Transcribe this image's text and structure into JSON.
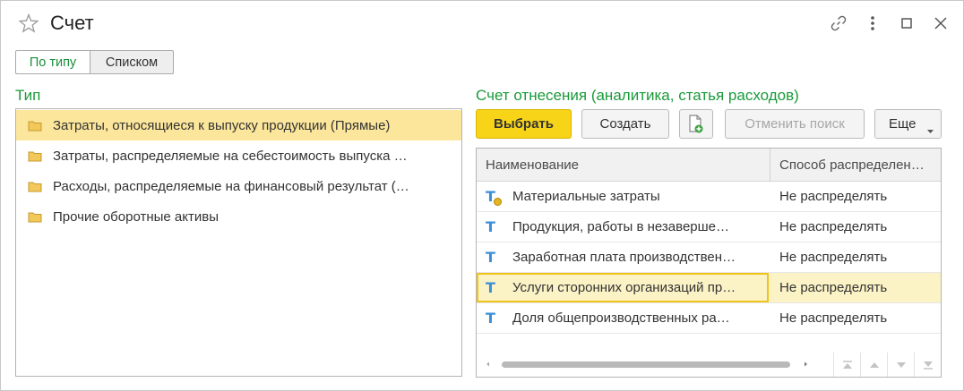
{
  "window": {
    "title": "Счет"
  },
  "view_toggle": {
    "by_type": "По типу",
    "by_list": "Списком"
  },
  "left": {
    "section_label": "Тип",
    "items": [
      {
        "label": "Затраты, относящиеся к выпуску продукции (Прямые)",
        "selected": true
      },
      {
        "label": "Затраты, распределяемые на себестоимость выпуска …",
        "selected": false
      },
      {
        "label": "Расходы, распределяемые на финансовый результат (…",
        "selected": false
      },
      {
        "label": "Прочие оборотные активы",
        "selected": false
      }
    ]
  },
  "right": {
    "section_label": "Счет отнесения (аналитика, статья расходов)",
    "toolbar": {
      "select": "Выбрать",
      "create": "Создать",
      "cancel_search": "Отменить поиск",
      "more": "Еще"
    },
    "table": {
      "columns": [
        "Наименование",
        "Способ распределен…"
      ],
      "rows": [
        {
          "name": "Материальные затраты",
          "method": "Не распределять",
          "icon": "type-icon-marked",
          "selected": false
        },
        {
          "name": "Продукция, работы в незаверше…",
          "method": "Не распределять",
          "icon": "type-icon",
          "selected": false
        },
        {
          "name": "Заработная плата производствен…",
          "method": "Не распределять",
          "icon": "type-icon",
          "selected": false
        },
        {
          "name": "Услуги сторонних организаций пр…",
          "method": "Не распределять",
          "icon": "type-icon",
          "selected": true
        },
        {
          "name": "Доля общепроизводственных ра…",
          "method": "Не распределять",
          "icon": "type-icon",
          "selected": false
        }
      ]
    }
  },
  "colors": {
    "accent_green": "#1a9a3a",
    "primary_button": "#f7d417",
    "selection": "#fbe69b",
    "type_icon": "#3b8fd8"
  }
}
